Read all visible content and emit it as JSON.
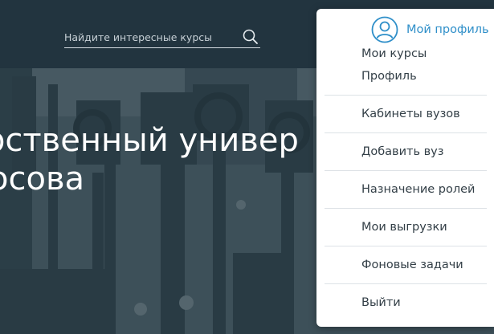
{
  "search": {
    "placeholder": "Найдите интересные курсы",
    "icon": "search-icon"
  },
  "hero": {
    "title_line1": "рственный универ",
    "title_line2": "осова"
  },
  "profile_menu": {
    "profile_label": "Мой профиль",
    "avatar_icon": "user-avatar-icon",
    "accent_color": "#2f8fc9",
    "items": [
      {
        "label": "Мои курсы"
      },
      {
        "label": "Профиль"
      },
      {
        "label": "Кабинеты вузов"
      },
      {
        "label": "Добавить вуз"
      },
      {
        "label": "Назначение ролей"
      },
      {
        "label": "Мои выгрузки"
      },
      {
        "label": "Фоновые задачи"
      },
      {
        "label": "Выйти"
      }
    ]
  }
}
